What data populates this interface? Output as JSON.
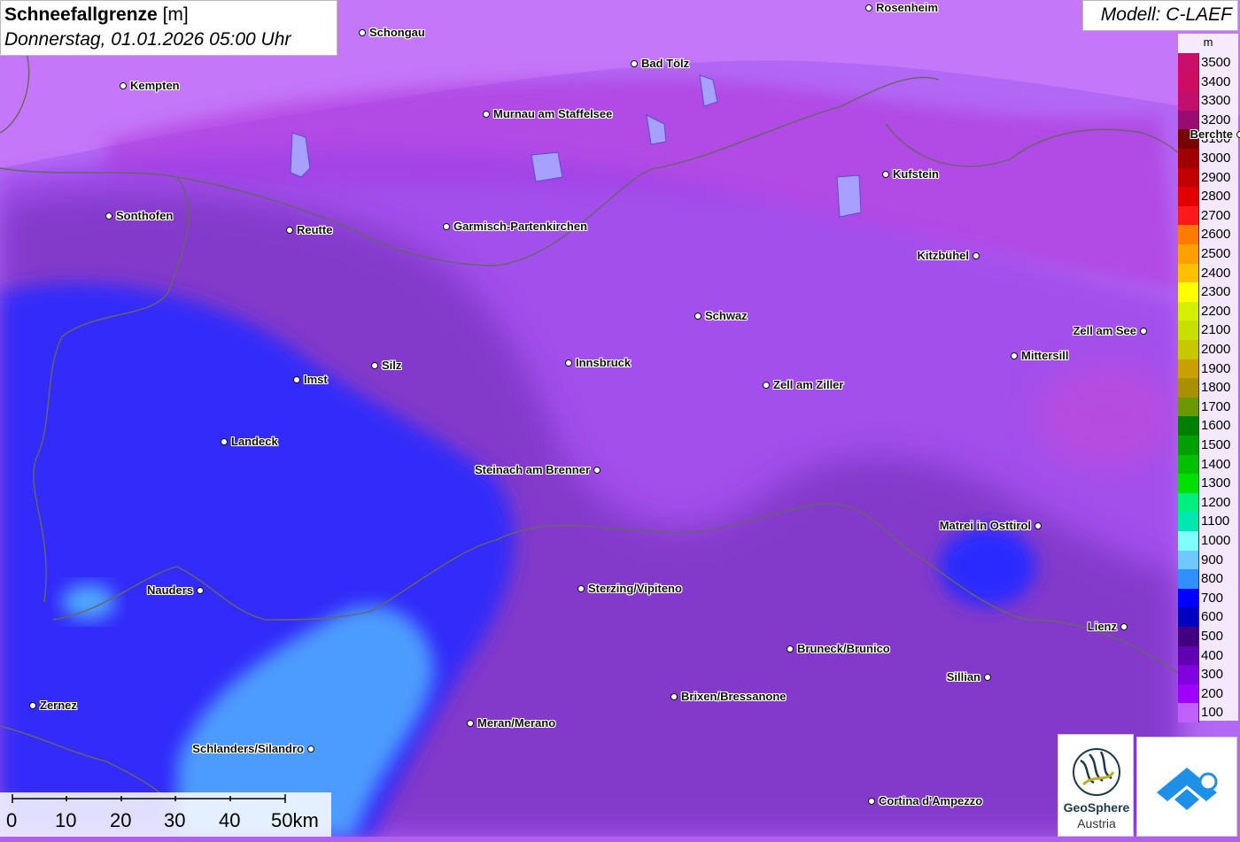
{
  "title": {
    "parameter": "Schneefallgrenze",
    "unit": "[m]",
    "datetime": "Donnerstag, 01.01.2026 05:00 Uhr"
  },
  "model_label": "Modell: C-LAEF",
  "legend": {
    "unit": "m",
    "items": [
      {
        "label": "3500",
        "color": "#c8106a"
      },
      {
        "label": "3400",
        "color": "#cc0e62"
      },
      {
        "label": "3300",
        "color": "#c0106e"
      },
      {
        "label": "3200",
        "color": "#9c0c70"
      },
      {
        "label": "3100",
        "color": "#7a0000"
      },
      {
        "label": "3000",
        "color": "#a00000"
      },
      {
        "label": "2900",
        "color": "#c00000"
      },
      {
        "label": "2800",
        "color": "#e00000"
      },
      {
        "label": "2700",
        "color": "#ff1a1a"
      },
      {
        "label": "2600",
        "color": "#ff7a00"
      },
      {
        "label": "2500",
        "color": "#ffa000"
      },
      {
        "label": "2400",
        "color": "#ffc000"
      },
      {
        "label": "2300",
        "color": "#ffff00"
      },
      {
        "label": "2200",
        "color": "#d4f000"
      },
      {
        "label": "2100",
        "color": "#c8e000"
      },
      {
        "label": "2000",
        "color": "#c8c800"
      },
      {
        "label": "1900",
        "color": "#c8a000"
      },
      {
        "label": "1800",
        "color": "#a89000"
      },
      {
        "label": "1700",
        "color": "#6a9a00"
      },
      {
        "label": "1600",
        "color": "#008000"
      },
      {
        "label": "1500",
        "color": "#00a000"
      },
      {
        "label": "1400",
        "color": "#00c000"
      },
      {
        "label": "1300",
        "color": "#00e000"
      },
      {
        "label": "1200",
        "color": "#00f080"
      },
      {
        "label": "1100",
        "color": "#00e8b0"
      },
      {
        "label": "1000",
        "color": "#80ffff"
      },
      {
        "label": "900",
        "color": "#70c8ff"
      },
      {
        "label": "800",
        "color": "#3090ff"
      },
      {
        "label": "700",
        "color": "#0000ff"
      },
      {
        "label": "600",
        "color": "#0000c0"
      },
      {
        "label": "500",
        "color": "#400080"
      },
      {
        "label": "400",
        "color": "#6000b0"
      },
      {
        "label": "300",
        "color": "#8000e0"
      },
      {
        "label": "200",
        "color": "#a000ff"
      },
      {
        "label": "100",
        "color": "#c060ff"
      }
    ]
  },
  "cities": [
    {
      "name": "Rosenheim"
    },
    {
      "name": "Schongau"
    },
    {
      "name": "Bad Tölz"
    },
    {
      "name": "Kempten"
    },
    {
      "name": "Murnau am Staffelsee"
    },
    {
      "name": "Berchte"
    },
    {
      "name": "Kufstein"
    },
    {
      "name": "Sonthofen"
    },
    {
      "name": "Reutte"
    },
    {
      "name": "Garmisch-Partenkirchen"
    },
    {
      "name": "Kitzbühel"
    },
    {
      "name": "Schwaz"
    },
    {
      "name": "Zell am See"
    },
    {
      "name": "Mittersill"
    },
    {
      "name": "Imst"
    },
    {
      "name": "Silz"
    },
    {
      "name": "Innsbruck"
    },
    {
      "name": "Zell am Ziller"
    },
    {
      "name": "Landeck"
    },
    {
      "name": "Steinach am Brenner"
    },
    {
      "name": "Matrei in Osttirol"
    },
    {
      "name": "Nauders"
    },
    {
      "name": "Sterzing/Vipiteno"
    },
    {
      "name": "Lienz"
    },
    {
      "name": "Bruneck/Brunico"
    },
    {
      "name": "Sillian"
    },
    {
      "name": "Brixen/Bressanone"
    },
    {
      "name": "Zernez"
    },
    {
      "name": "Meran/Merano"
    },
    {
      "name": "Schlanders/Silandro"
    },
    {
      "name": "Cortina d'Ampezzo"
    }
  ],
  "scale_bar": {
    "labels": [
      "0",
      "10",
      "20",
      "30",
      "40",
      "50km"
    ]
  },
  "logos": {
    "geosphere_line1": "GeoSphere",
    "geosphere_line2": "Austria"
  }
}
